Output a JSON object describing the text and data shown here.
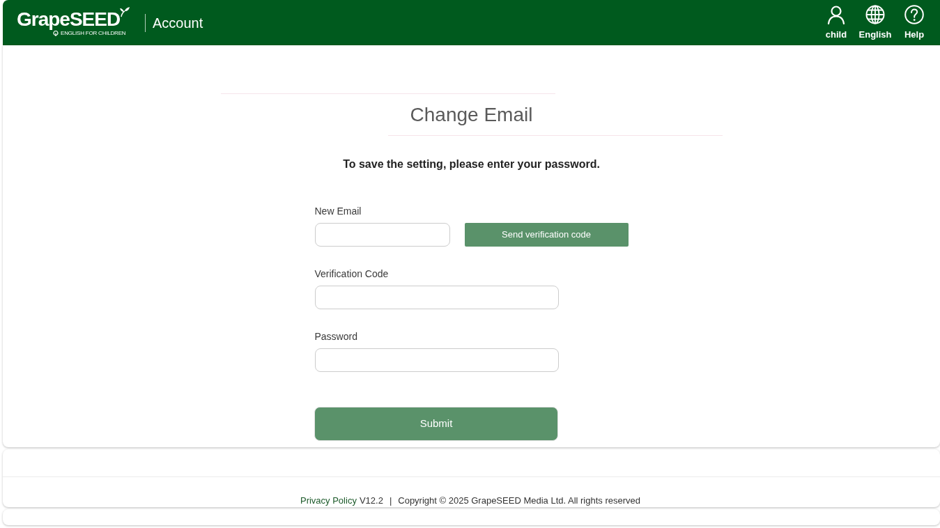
{
  "header": {
    "logo": {
      "wordmark": "GrapeSEED",
      "tagline": "ENGLISH FOR CHILDREN"
    },
    "section": "Account",
    "actions": [
      {
        "kind": "user",
        "label": "child"
      },
      {
        "kind": "language",
        "label": "English"
      },
      {
        "kind": "help",
        "label": "Help"
      }
    ]
  },
  "form": {
    "title": "Change Email",
    "instruction": "To save the setting, please enter your password.",
    "fields": [
      {
        "label": "New Email",
        "action": "Send verification code"
      },
      {
        "label": "Verification Code"
      },
      {
        "label": "Password"
      }
    ],
    "submit": "Submit"
  },
  "footer": {
    "link": "Privacy Policy",
    "version": "V12.2",
    "separator": "|",
    "copyright": "Copyright © 2025 GrapeSEED Media Ltd. All rights reserved"
  }
}
